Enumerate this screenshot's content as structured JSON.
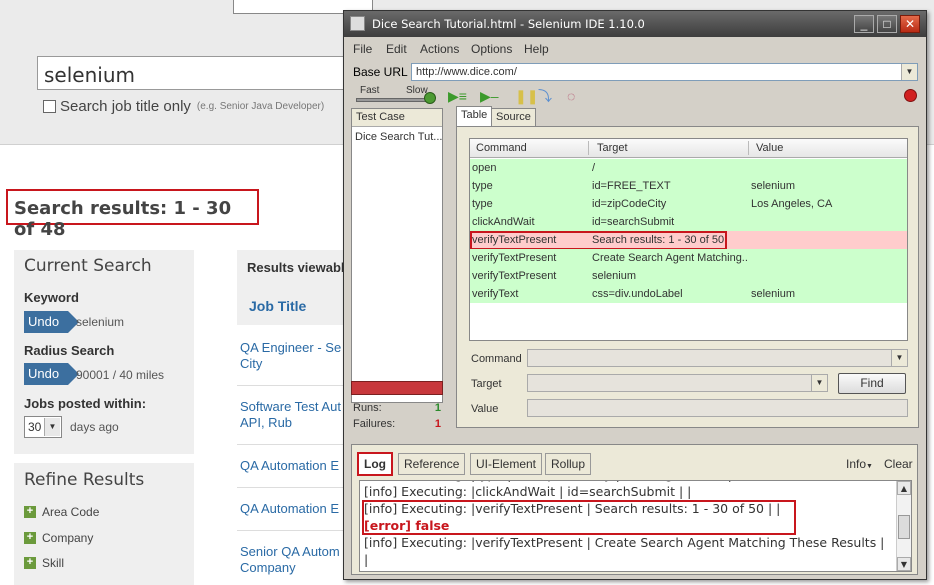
{
  "dice": {
    "search_value": "selenium",
    "checkbox_label": "Search job title only",
    "checkbox_hint": "(e.g. Senior Java Developer)",
    "results_heading": "Search results: 1 - 30 of 48",
    "current_search": {
      "title": "Current Search",
      "keyword_label": "Keyword",
      "undo_label": "Undo",
      "keyword_value": "selenium",
      "radius_label": "Radius Search",
      "radius_value": "90001 / 40 miles",
      "posted_label": "Jobs posted within:",
      "days_value": "30",
      "days_suffix": "days ago"
    },
    "refine": {
      "title": "Refine Results",
      "items": [
        "Area Code",
        "Company",
        "Skill"
      ]
    },
    "jobs": {
      "viewable_label": "Results viewable",
      "job_title_header": "Job Title",
      "listings": [
        {
          "line1": "QA Engineer - Se",
          "line2": "City"
        },
        {
          "line1": "Software Test Aut",
          "line2": "API, Rub"
        },
        {
          "line1": "QA Automation E",
          "line2": ""
        },
        {
          "line1": "QA Automation E",
          "line2": ""
        },
        {
          "line1": "Senior QA Autom",
          "line2": "Company"
        }
      ]
    }
  },
  "ide": {
    "window_title": "Dice Search Tutorial.html - Selenium IDE 1.10.0",
    "window_buttons": {
      "minimize": "_",
      "maximize": "□",
      "close": "✕"
    },
    "menu": [
      "File",
      "Edit",
      "Actions",
      "Options",
      "Help"
    ],
    "base_url_label": "Base URL",
    "base_url_value": "http://www.dice.com/",
    "speed": {
      "fast": "Fast",
      "slow": "Slow"
    },
    "test_case_header": "Test Case",
    "test_case_item": "Dice Search Tut...",
    "runs_label": "Runs:",
    "runs_value": "1",
    "failures_label": "Failures:",
    "failures_value": "1",
    "tabs": {
      "table": "Table",
      "source": "Source"
    },
    "columns": {
      "command": "Command",
      "target": "Target",
      "value": "Value"
    },
    "commands": [
      {
        "command": "open",
        "target": "/",
        "value": "",
        "status": "pass"
      },
      {
        "command": "type",
        "target": "id=FREE_TEXT",
        "value": "selenium",
        "status": "pass"
      },
      {
        "command": "type",
        "target": "id=zipCodeCity",
        "value": "Los Angeles, CA",
        "status": "pass"
      },
      {
        "command": "clickAndWait",
        "target": "id=searchSubmit",
        "value": "",
        "status": "pass"
      },
      {
        "command": "verifyTextPresent",
        "target": "Search results: 1 - 30 of 50",
        "value": "",
        "status": "fail"
      },
      {
        "command": "verifyTextPresent",
        "target": "Create Search Agent Matching...",
        "value": "",
        "status": "pass"
      },
      {
        "command": "verifyTextPresent",
        "target": "selenium",
        "value": "",
        "status": "pass"
      },
      {
        "command": "verifyText",
        "target": "css=div.undoLabel",
        "value": "selenium",
        "status": "pass"
      }
    ],
    "fields": {
      "command": "Command",
      "target": "Target",
      "value": "Value",
      "find": "Find"
    },
    "log_tabs": [
      "Log",
      "Reference",
      "UI-Element",
      "Rollup"
    ],
    "log_level": "Info",
    "clear": "Clear",
    "log_lines": [
      {
        "text": "[info] Executing: |type | id=zipCodeCity | Los Angeles, CA |",
        "error": false
      },
      {
        "text": "[info] Executing: |clickAndWait | id=searchSubmit | |",
        "error": false
      },
      {
        "text": "[info] Executing: |verifyTextPresent | Search results: 1 - 30 of 50 | |",
        "error": false
      },
      {
        "text": "[error] false",
        "error": true
      },
      {
        "text": "[info] Executing: |verifyTextPresent | Create Search Agent Matching These Results |",
        "error": false
      },
      {
        "text": "|",
        "error": false
      },
      {
        "text": "[info] Executing: |verifyTextPresent | selenium | |",
        "error": false
      }
    ],
    "colors": {
      "pass_row": "#ccffcc",
      "fail_row": "#ffcccc",
      "highlight": "#c8161d"
    }
  }
}
